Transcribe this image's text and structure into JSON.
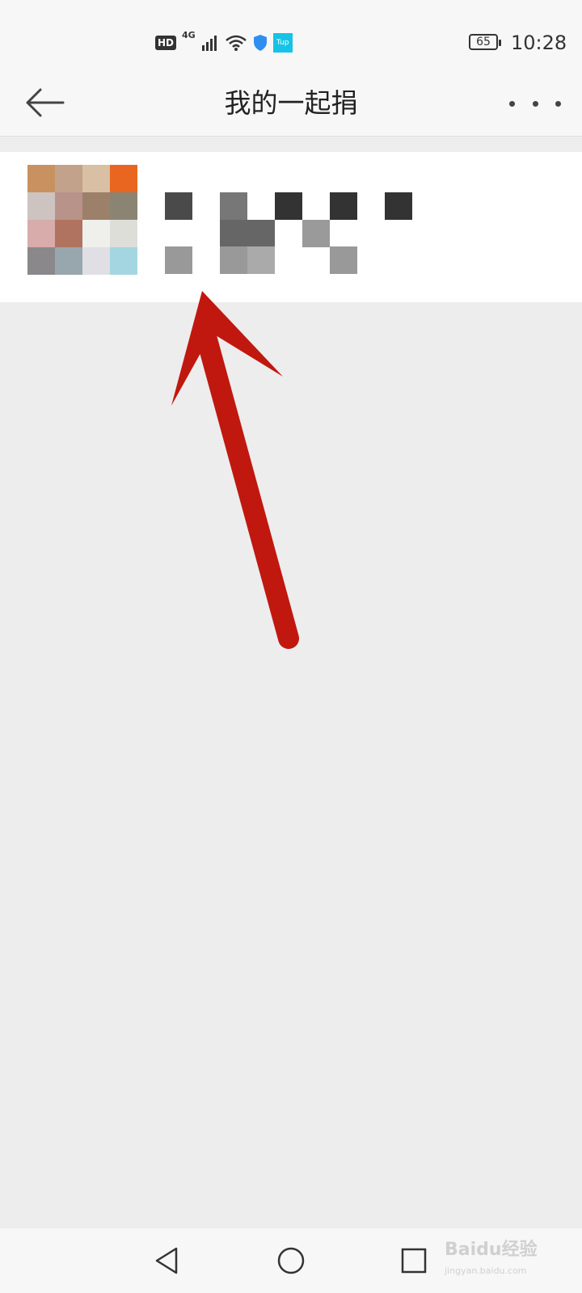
{
  "status_bar": {
    "hd_label": "HD",
    "network_label": "4G",
    "tup_label": "Tup",
    "battery_level": "65",
    "time": "10:28"
  },
  "header": {
    "back_icon": "arrow-left-icon",
    "title": "我的一起捐",
    "more_icon": "more-dots-icon"
  },
  "donation_list": [
    {
      "thumbnail": "pixelated-thumbnail",
      "title": "",
      "amount": ""
    }
  ],
  "annotation": {
    "arrow_color": "#c0180f",
    "arrow_icon": "red-arrow-icon"
  },
  "nav_bar": {
    "back_icon": "triangle-back-icon",
    "home_icon": "circle-home-icon",
    "recent_icon": "square-recent-icon"
  },
  "watermark": {
    "brand": "Baidu经验",
    "url": "jingyan.baidu.com"
  }
}
